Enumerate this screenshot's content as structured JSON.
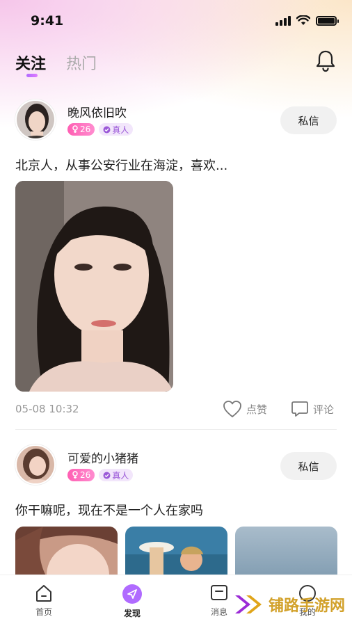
{
  "status": {
    "time": "9:41"
  },
  "tabs": {
    "follow": "关注",
    "hot": "热门"
  },
  "posts": [
    {
      "username": "晚风依旧吹",
      "age": "26",
      "verified": "真人",
      "dm_label": "私信",
      "text": "北京人，从事公安行业在海淀，喜欢...",
      "time": "05-08 10:32",
      "like_label": "点赞",
      "comment_label": "评论"
    },
    {
      "username": "可爱的小猪猪",
      "age": "26",
      "verified": "真人",
      "dm_label": "私信",
      "text": "你干嘛呢，现在不是一个人在家吗"
    }
  ],
  "tabbar": [
    {
      "label": "首页",
      "icon": "home-icon"
    },
    {
      "label": "发现",
      "icon": "discover-icon"
    },
    {
      "label": "消息",
      "icon": "message-icon"
    },
    {
      "label": "我的",
      "icon": "profile-icon"
    }
  ],
  "watermark": {
    "text": "铺路手游网"
  },
  "colors": {
    "accent": "#b06bff",
    "badge_pink": "#ff5fb3",
    "watermark": "#d2a12a"
  }
}
